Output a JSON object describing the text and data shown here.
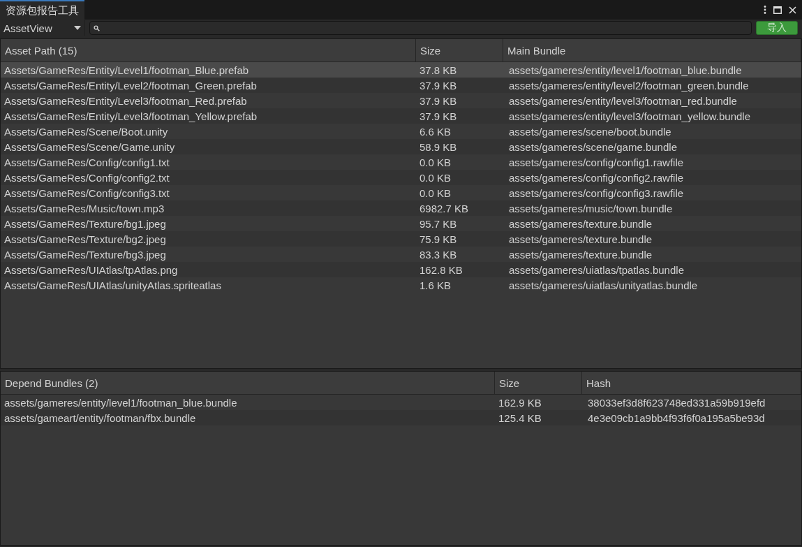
{
  "window": {
    "title": "资源包报告工具",
    "tab_selected": true
  },
  "toolbar": {
    "view_dropdown": "AssetView",
    "import_button": "导入"
  },
  "assets_table": {
    "columns": [
      "Asset Path (15)",
      "Size",
      "Main Bundle"
    ],
    "rows": [
      {
        "cells": [
          "Assets/GameRes/Entity/Level1/footman_Blue.prefab",
          "37.8 KB",
          "assets/gameres/entity/level1/footman_blue.bundle"
        ],
        "selected": true
      },
      {
        "cells": [
          "Assets/GameRes/Entity/Level2/footman_Green.prefab",
          "37.9 KB",
          "assets/gameres/entity/level2/footman_green.bundle"
        ],
        "selected": false
      },
      {
        "cells": [
          "Assets/GameRes/Entity/Level3/footman_Red.prefab",
          "37.9 KB",
          "assets/gameres/entity/level3/footman_red.bundle"
        ],
        "selected": false
      },
      {
        "cells": [
          "Assets/GameRes/Entity/Level3/footman_Yellow.prefab",
          "37.9 KB",
          "assets/gameres/entity/level3/footman_yellow.bundle"
        ],
        "selected": false
      },
      {
        "cells": [
          "Assets/GameRes/Scene/Boot.unity",
          "6.6 KB",
          "assets/gameres/scene/boot.bundle"
        ],
        "selected": false
      },
      {
        "cells": [
          "Assets/GameRes/Scene/Game.unity",
          "58.9 KB",
          "assets/gameres/scene/game.bundle"
        ],
        "selected": false
      },
      {
        "cells": [
          "Assets/GameRes/Config/config1.txt",
          "0.0 KB",
          "assets/gameres/config/config1.rawfile"
        ],
        "selected": false
      },
      {
        "cells": [
          "Assets/GameRes/Config/config2.txt",
          "0.0 KB",
          "assets/gameres/config/config2.rawfile"
        ],
        "selected": false
      },
      {
        "cells": [
          "Assets/GameRes/Config/config3.txt",
          "0.0 KB",
          "assets/gameres/config/config3.rawfile"
        ],
        "selected": false
      },
      {
        "cells": [
          "Assets/GameRes/Music/town.mp3",
          "6982.7 KB",
          "assets/gameres/music/town.bundle"
        ],
        "selected": false
      },
      {
        "cells": [
          "Assets/GameRes/Texture/bg1.jpeg",
          "95.7 KB",
          "assets/gameres/texture.bundle"
        ],
        "selected": false
      },
      {
        "cells": [
          "Assets/GameRes/Texture/bg2.jpeg",
          "75.9 KB",
          "assets/gameres/texture.bundle"
        ],
        "selected": false
      },
      {
        "cells": [
          "Assets/GameRes/Texture/bg3.jpeg",
          "83.3 KB",
          "assets/gameres/texture.bundle"
        ],
        "selected": false
      },
      {
        "cells": [
          "Assets/GameRes/UIAtlas/tpAtlas.png",
          "162.8 KB",
          "assets/gameres/uiatlas/tpatlas.bundle"
        ],
        "selected": false
      },
      {
        "cells": [
          "Assets/GameRes/UIAtlas/unityAtlas.spriteatlas",
          "1.6 KB",
          "assets/gameres/uiatlas/unityatlas.bundle"
        ],
        "selected": false
      }
    ]
  },
  "depend_table": {
    "columns": [
      "Depend Bundles (2)",
      "Size",
      "Hash"
    ],
    "rows": [
      {
        "cells": [
          "assets/gameres/entity/level1/footman_blue.bundle",
          "162.9 KB",
          "38033ef3d8f623748ed331a59b919efd"
        ],
        "selected": false
      },
      {
        "cells": [
          "assets/gameart/entity/footman/fbx.bundle",
          "125.4 KB",
          "4e3e09cb1a9bb4f93f6f0a195a5be93d"
        ],
        "selected": false
      }
    ]
  }
}
